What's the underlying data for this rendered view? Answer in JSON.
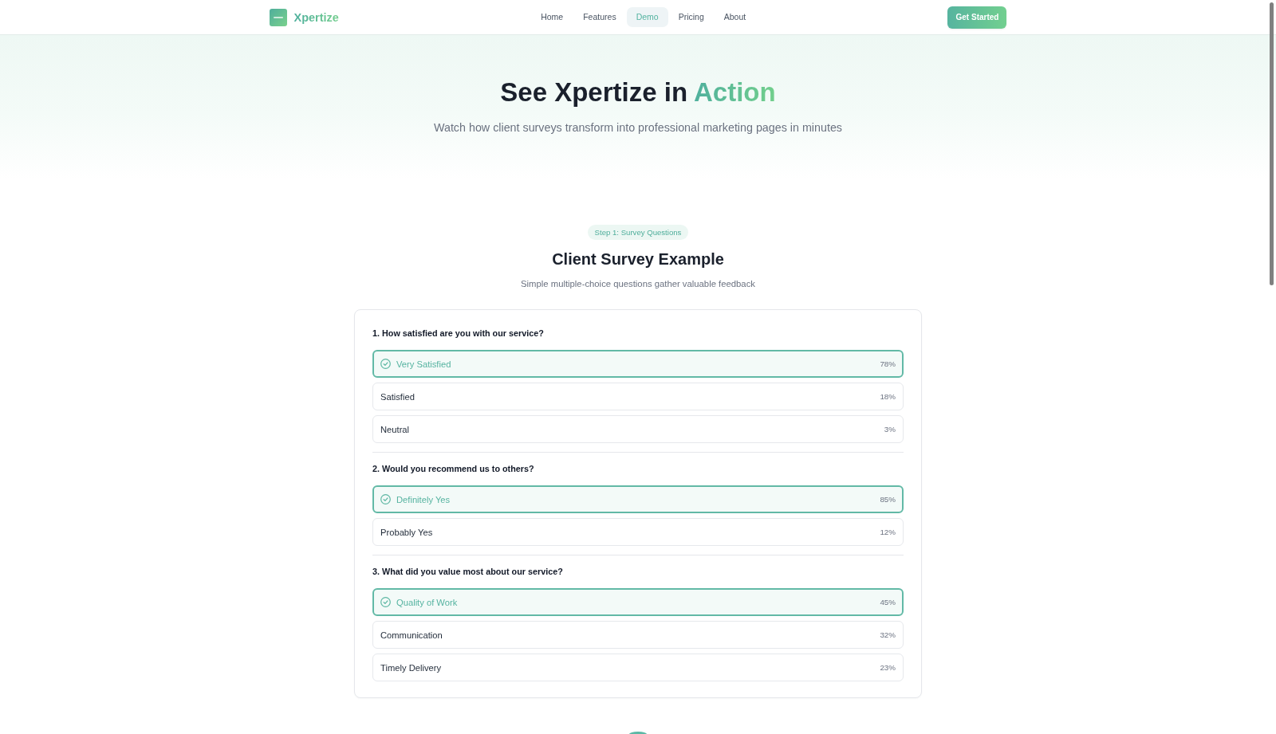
{
  "header": {
    "logo": {
      "name": "Xpertize"
    },
    "nav": [
      {
        "label": "Home",
        "selected": false
      },
      {
        "label": "Features",
        "selected": false
      },
      {
        "label": "Demo",
        "selected": true
      },
      {
        "label": "Pricing",
        "selected": false
      },
      {
        "label": "About",
        "selected": false
      }
    ],
    "cta": "Get Started"
  },
  "hero": {
    "title": "See Xpertize in",
    "title_highlight": "Action",
    "subtitle": "Watch how client surveys transform into professional marketing pages in minutes"
  },
  "survey": {
    "step_badge": "Step 1: Survey Questions",
    "title": "Client Survey Example",
    "subtitle": "Simple multiple-choice questions gather valuable feedback",
    "questions": [
      {
        "question": "1. How satisfied are you with our service?",
        "options": [
          {
            "label": "Very Satisfied",
            "share": "78%",
            "selected": true
          },
          {
            "label": "Satisfied",
            "share": "18%",
            "selected": false
          },
          {
            "label": "Neutral",
            "share": "3%",
            "selected": false
          }
        ]
      },
      {
        "question": "2. Would you recommend us to others?",
        "options": [
          {
            "label": "Definitely Yes",
            "share": "85%",
            "selected": true
          },
          {
            "label": "Probably Yes",
            "share": "12%",
            "selected": false
          }
        ]
      },
      {
        "question": "3. What did you value most about our service?",
        "options": [
          {
            "label": "Quality of Work",
            "share": "45%",
            "selected": true
          },
          {
            "label": "Communication",
            "share": "32%",
            "selected": false
          },
          {
            "label": "Timely Delivery",
            "share": "23%",
            "selected": false
          }
        ]
      }
    ]
  }
}
